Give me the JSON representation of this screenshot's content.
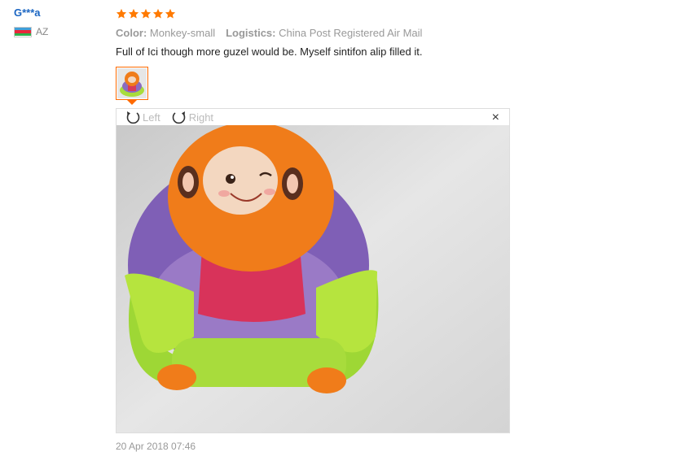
{
  "reviewer": {
    "name": "G***a",
    "country": "AZ"
  },
  "rating": {
    "stars": 5,
    "max": 5
  },
  "meta": {
    "color_label": "Color:",
    "color_value": "Monkey-small",
    "logistics_label": "Logistics:",
    "logistics_value": "China Post Registered Air Mail"
  },
  "review_text": "Full of Ici though more guzel would be. Myself sintifon alip filled it.",
  "viewer": {
    "rotate_left": "Left",
    "rotate_right": "Right",
    "close": "×"
  },
  "date": "20 Apr 2018 07:46",
  "colors": {
    "name": "#1a65c2",
    "star": "#ff7a00",
    "accent": "#ff6a00"
  }
}
